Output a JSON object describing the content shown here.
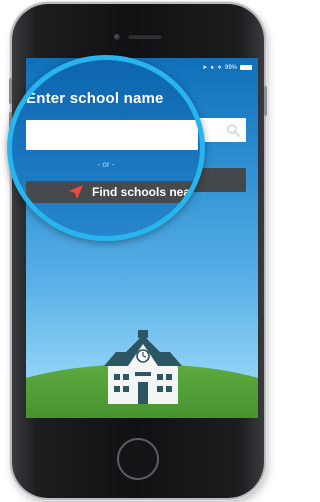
{
  "status_bar": {
    "battery_text": "99%"
  },
  "search": {
    "heading": "Enter school name",
    "input_value": "",
    "separator_text": "- or -",
    "find_button_label": "Find schools near me"
  },
  "icons": {
    "search": "search-icon",
    "locate": "location-arrow-icon",
    "school": "school-building-icon"
  },
  "colors": {
    "accent_blue": "#28b5ef",
    "button_dark": "#46494e",
    "location_red": "#ef4a3c",
    "grass_green": "#3f8d2b",
    "school_roof": "#2d5663"
  }
}
